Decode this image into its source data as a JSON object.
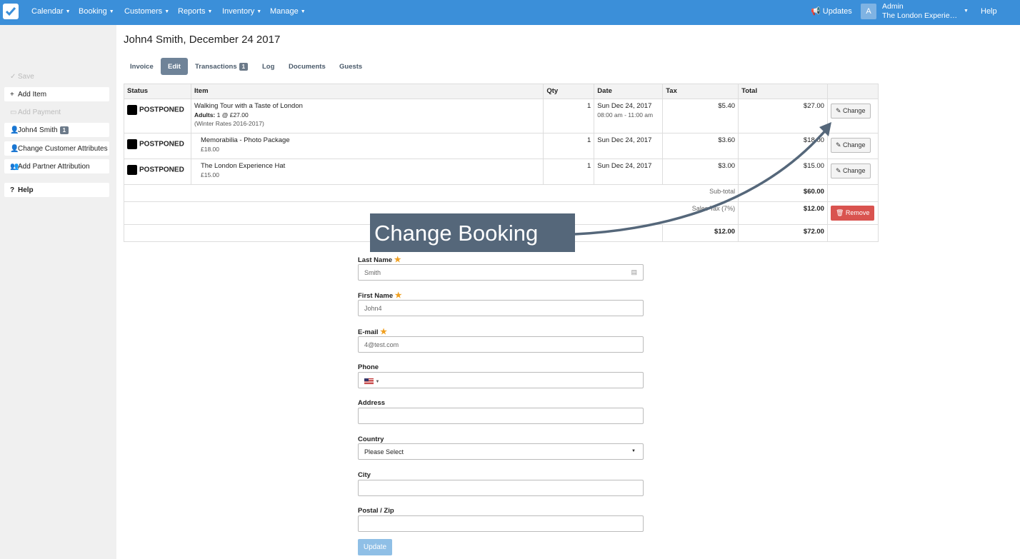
{
  "nav": {
    "menu": [
      "Calendar",
      "Booking",
      "Customers",
      "Reports",
      "Inventory",
      "Manage"
    ],
    "updates": "Updates",
    "avatar_letter": "A",
    "admin_name": "Admin",
    "admin_org": "The London Experience",
    "help": "Help",
    "accent": "#3b8fd9"
  },
  "sidebar": {
    "save": "Save",
    "add_item": "Add Item",
    "add_payment": "Add Payment",
    "customer": "John4 Smith",
    "customer_badge": "1",
    "change_attributes": "Change Customer Attributes",
    "add_partner": "Add Partner Attribution",
    "help": "Help"
  },
  "page": {
    "title": "John4 Smith, December 24 2017",
    "tabs": [
      "Invoice",
      "Edit",
      "Transactions",
      "Log",
      "Documents",
      "Guests"
    ],
    "transactions_badge": "1"
  },
  "table": {
    "headers": [
      "Status",
      "Item",
      "Qty",
      "Date",
      "Tax",
      "Total"
    ],
    "rows": [
      {
        "status": "POSTPONED",
        "item": "Walking Tour with a Taste of London",
        "detail_label": "Adults:",
        "detail": "1 @ £27.00",
        "rate": "(Winter Rates 2016-2017)",
        "qty": "1",
        "date": "Sun Dec 24, 2017",
        "time": "08:00 am - 11:00 am",
        "tax": "$5.40",
        "total": "$27.00",
        "action": "Change"
      },
      {
        "status": "POSTPONED",
        "item": "Memorabilia - Photo Package",
        "price": "£18.00",
        "qty": "1",
        "date": "Sun Dec 24, 2017",
        "tax": "$3.60",
        "total": "$18.00",
        "action": "Change"
      },
      {
        "status": "POSTPONED",
        "item": "The London Experience Hat",
        "price": "£15.00",
        "qty": "1",
        "date": "Sun Dec 24, 2017",
        "tax": "$3.00",
        "total": "$15.00",
        "action": "Change"
      }
    ],
    "subtotal_label": "Sub-total",
    "subtotal": "$60.00",
    "sales_tax_label": "Sales Tax (7%)",
    "sales_tax": "$12.00",
    "remove": "Remove",
    "tax_total": "$12.00",
    "grand_total": "$72.00"
  },
  "callout": "Change Booking",
  "form": {
    "last_name_label": "Last Name",
    "last_name": "Smith",
    "first_name_label": "First Name",
    "first_name": "John4",
    "email_label": "E-mail",
    "email": "4@test.com",
    "phone_label": "Phone",
    "address_label": "Address",
    "country_label": "Country",
    "country": "Please Select",
    "city_label": "City",
    "postal_label": "Postal / Zip",
    "update": "Update"
  }
}
